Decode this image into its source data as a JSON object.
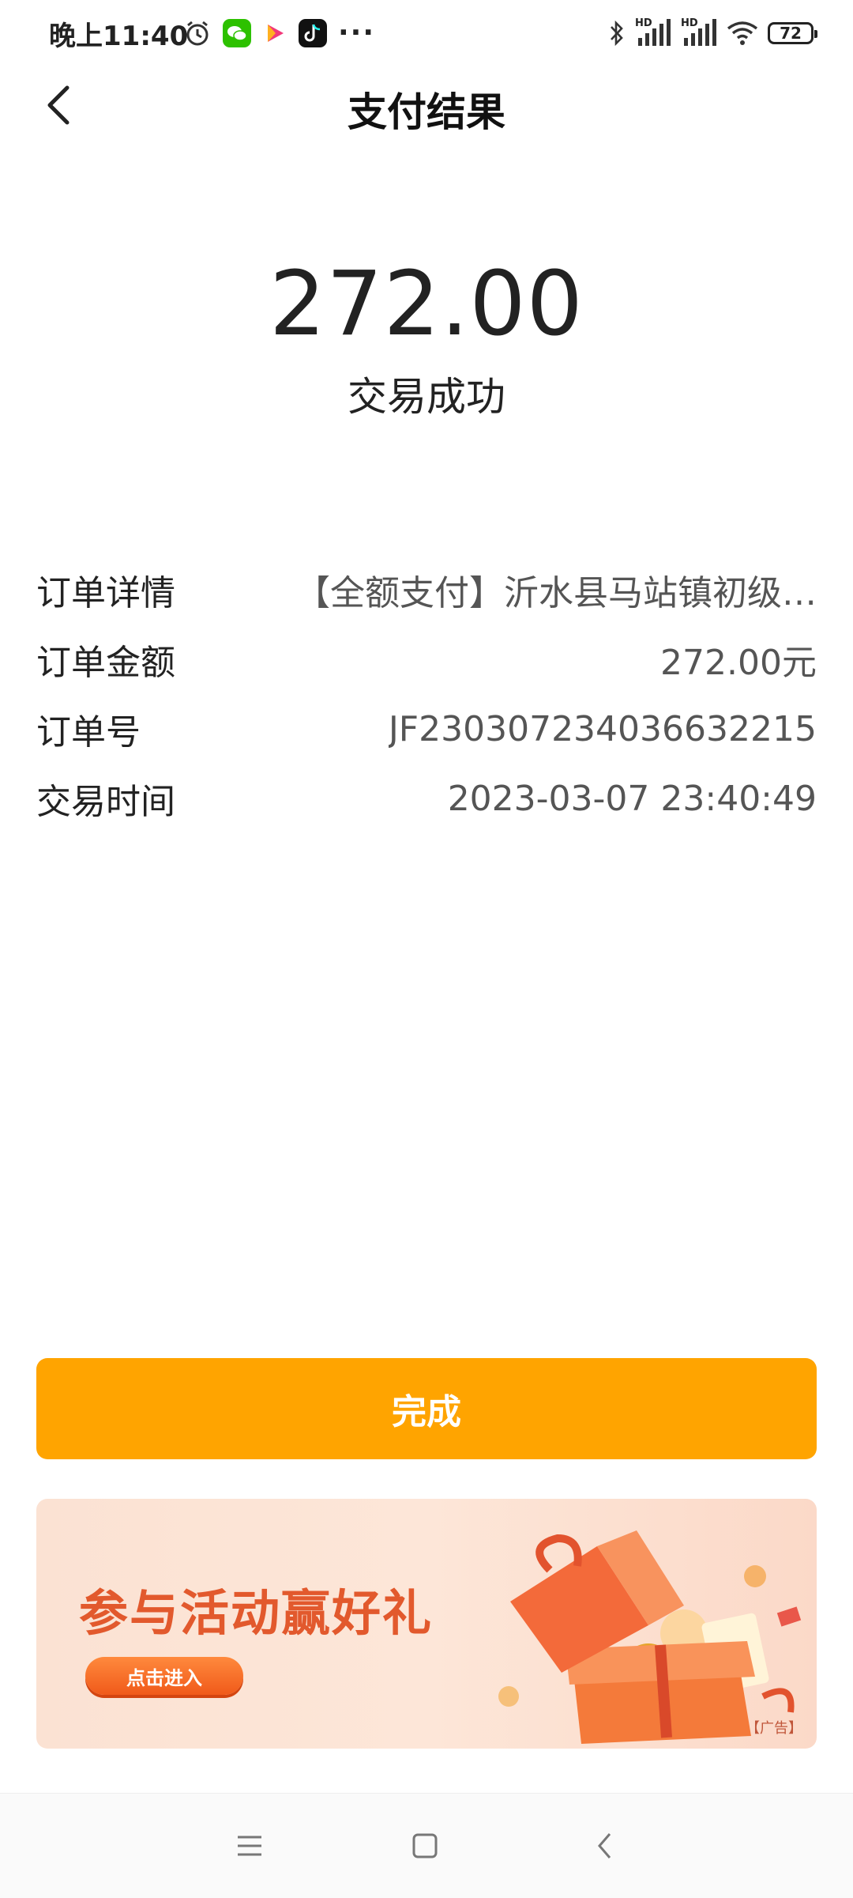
{
  "status_bar": {
    "time": "晚上11:40",
    "battery": "72",
    "left_icons": [
      "alarm-icon",
      "wechat-icon",
      "video-play-icon",
      "tiktok-icon",
      "more-icon"
    ],
    "right_icons": [
      "bluetooth-icon",
      "hd-signal-icon",
      "hd-signal-icon",
      "wifi-icon",
      "battery-icon"
    ],
    "hd_label": "HD"
  },
  "header": {
    "title": "支付结果",
    "back_icon": "chevron-left-icon"
  },
  "result": {
    "amount": "272.00",
    "status": "交易成功"
  },
  "details": [
    {
      "label": "订单详情",
      "value": "【全额支付】沂水县马站镇初级…"
    },
    {
      "label": "订单金额",
      "value": "272.00元"
    },
    {
      "label": "订单号",
      "value": "JF2303072340366322​15"
    },
    {
      "label": "交易时间",
      "value": "2023-03-07 23:40:49"
    }
  ],
  "done_button": {
    "label": "完成",
    "color": "#ffa400"
  },
  "banner": {
    "title": "参与活动赢好礼",
    "button": "点击进入",
    "ad_tag": "【广告】"
  },
  "nav": {
    "icons": [
      "menu-icon",
      "home-icon",
      "back-icon"
    ]
  }
}
